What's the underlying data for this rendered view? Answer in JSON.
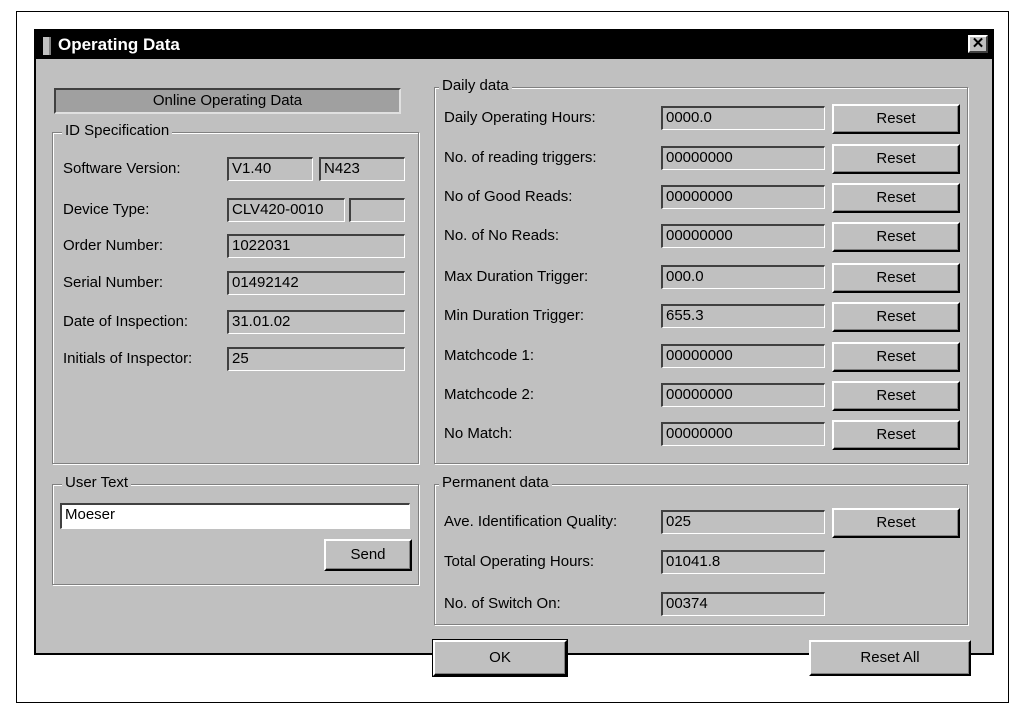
{
  "window": {
    "title": "Operating Data",
    "close_glyph": "✕"
  },
  "banner": "Online Operating Data",
  "id_spec": {
    "legend": "ID Specification",
    "rows": [
      {
        "label": "Software Version:",
        "value": "V1.40",
        "value2": "N423"
      },
      {
        "label": "Device Type:",
        "value": "CLV420-0010",
        "value2": ""
      },
      {
        "label": "Order Number:",
        "value": "1022031"
      },
      {
        "label": "Serial Number:",
        "value": "01492142"
      },
      {
        "label": "Date of Inspection:",
        "value": "31.01.02"
      },
      {
        "label": "Initials of Inspector:",
        "value": "25"
      }
    ]
  },
  "user_text": {
    "legend": "User Text",
    "value": "Moeser",
    "send_label": "Send"
  },
  "daily": {
    "legend": "Daily data",
    "reset_label": "Reset",
    "rows": [
      {
        "label": "Daily Operating Hours:",
        "value": "0000.0"
      },
      {
        "label": "No. of reading triggers:",
        "value": "00000000"
      },
      {
        "label": "No of Good Reads:",
        "value": "00000000"
      },
      {
        "label": "No. of No Reads:",
        "value": "00000000"
      },
      {
        "label": "Max Duration Trigger:",
        "value": "000.0"
      },
      {
        "label": "Min Duration Trigger:",
        "value": "655.3"
      },
      {
        "label": "Matchcode 1:",
        "value": "00000000"
      },
      {
        "label": "Matchcode 2:",
        "value": "00000000"
      },
      {
        "label": "No Match:",
        "value": "00000000"
      }
    ]
  },
  "permanent": {
    "legend": "Permanent data",
    "reset_label": "Reset",
    "rows": [
      {
        "label": "Ave. Identification Quality:",
        "value": "025"
      },
      {
        "label": "Total Operating Hours:",
        "value": "01041.8"
      },
      {
        "label": "No. of Switch On:",
        "value": "00374"
      }
    ]
  },
  "footer": {
    "ok_label": "OK",
    "reset_all_label": "Reset All"
  }
}
